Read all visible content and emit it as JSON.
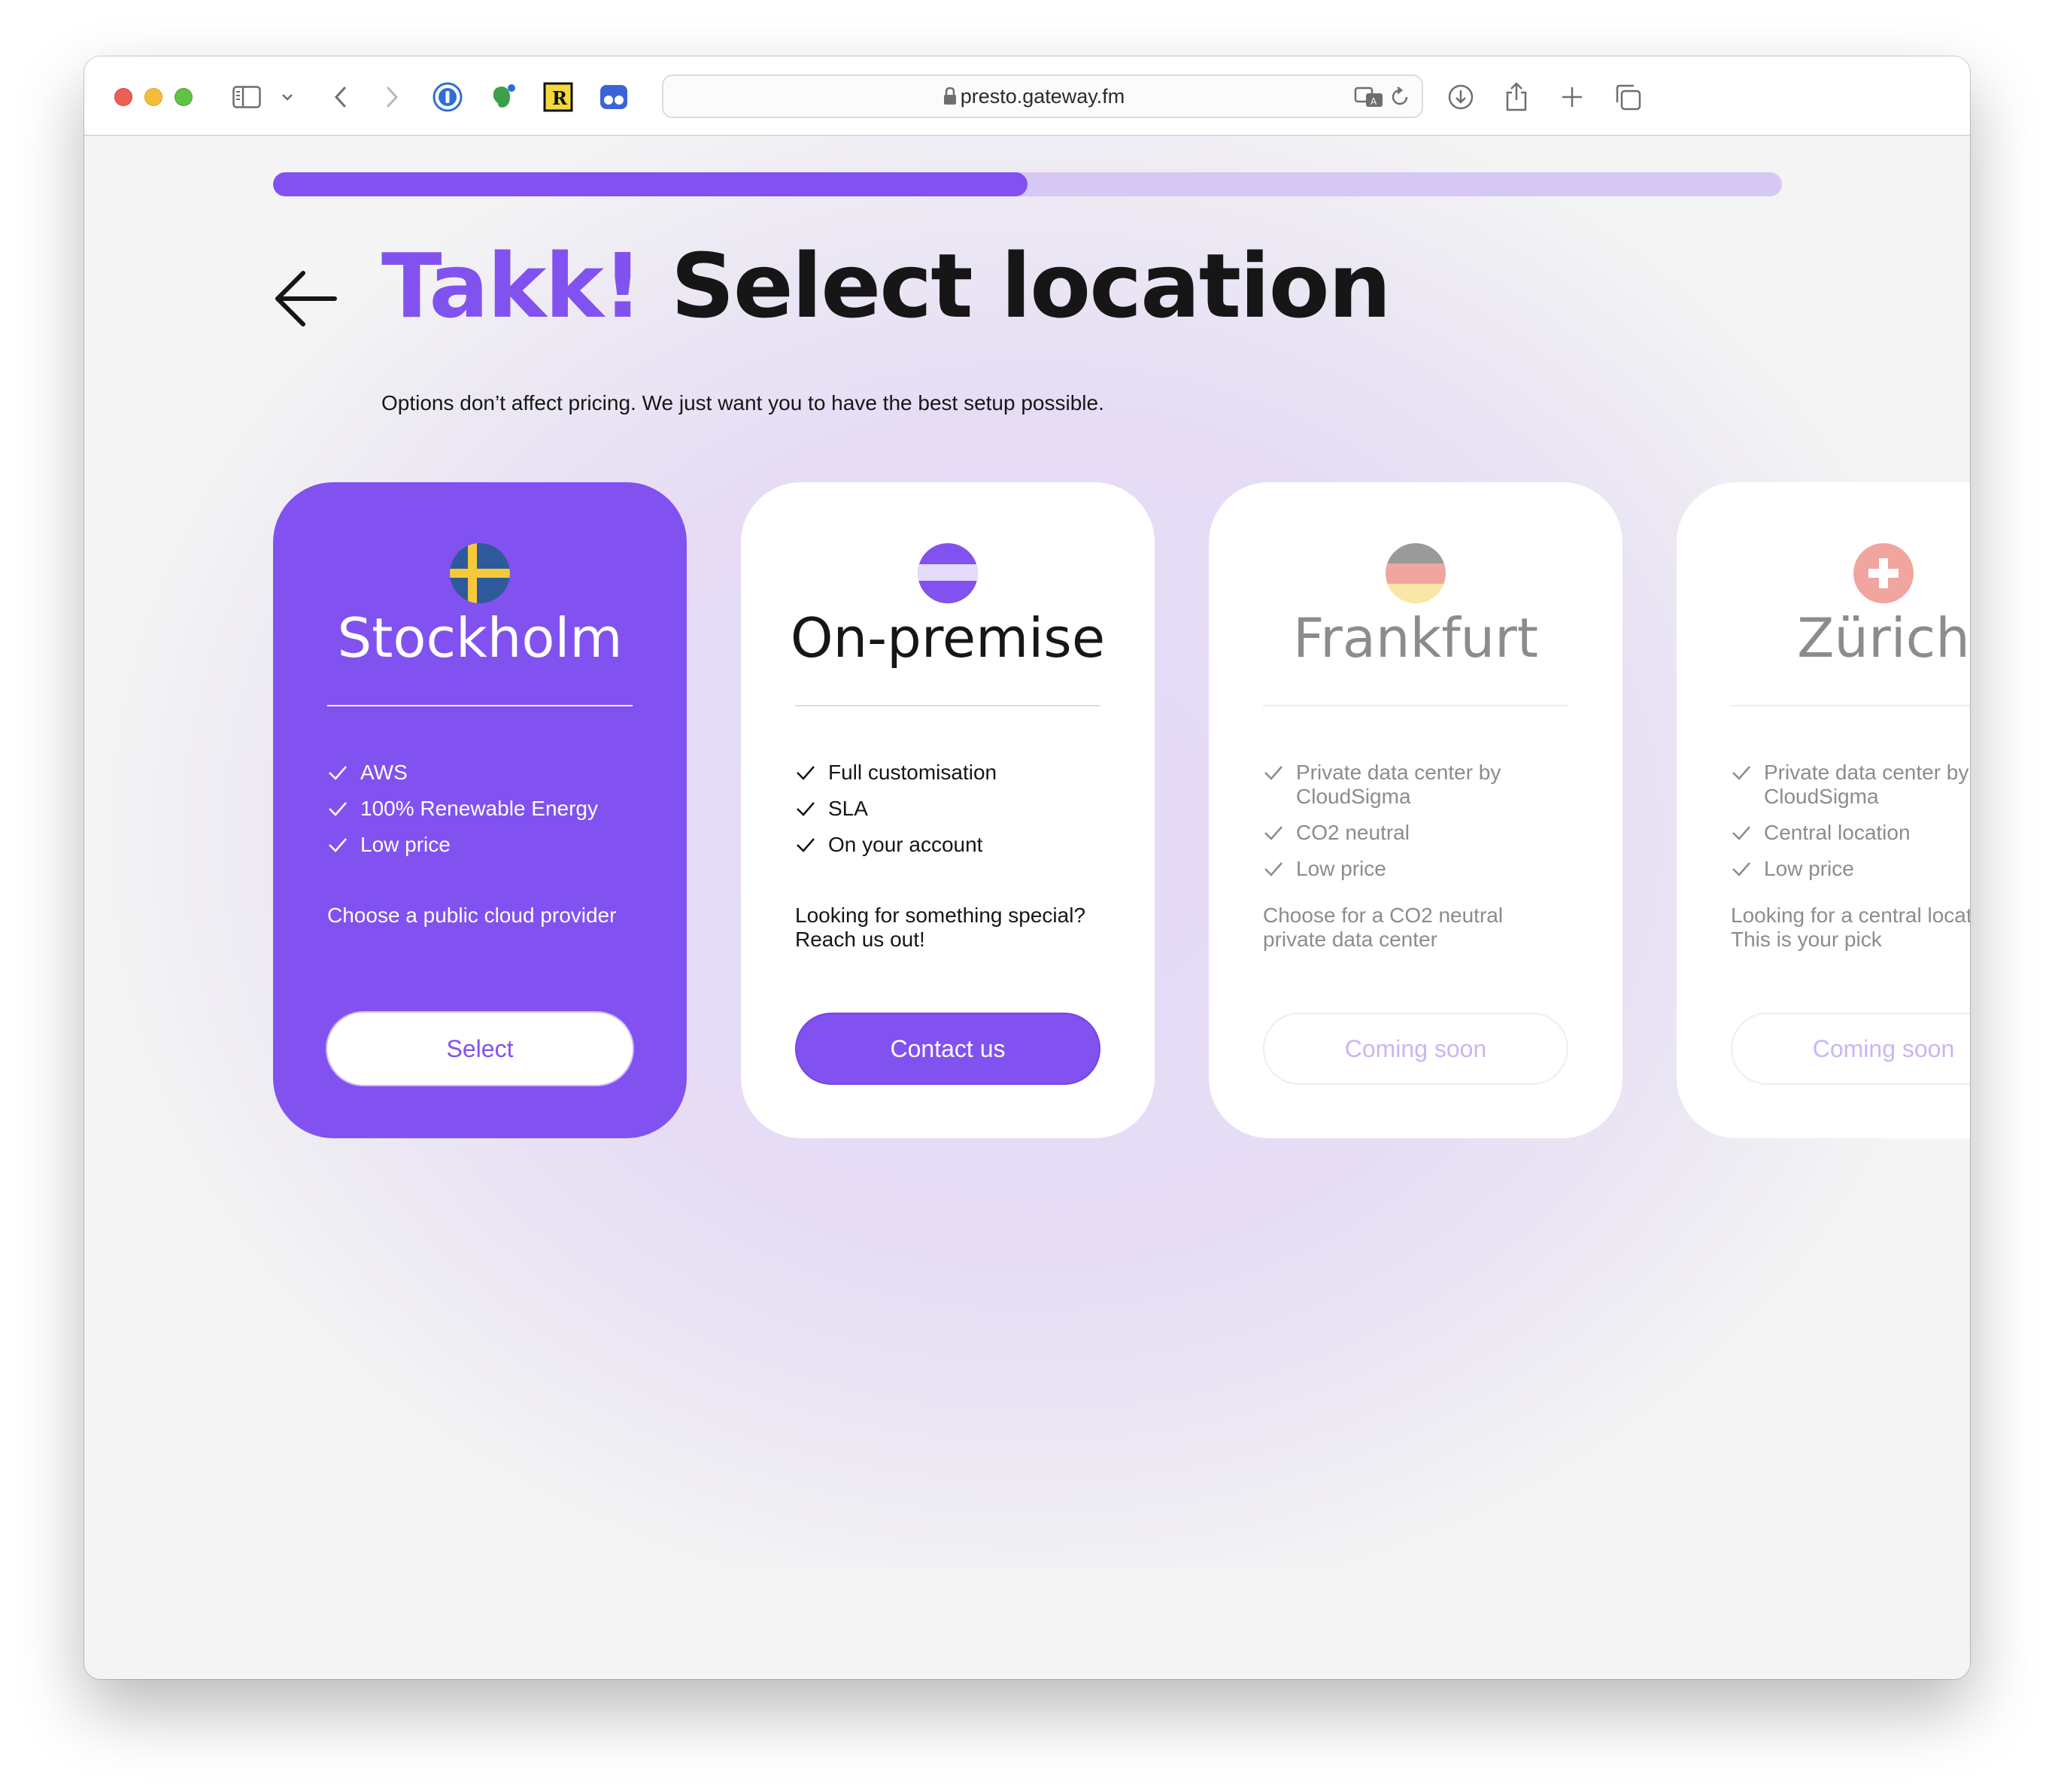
{
  "browser": {
    "url": "presto.gateway.fm",
    "toolbar_icons": [
      "sidebar-icon",
      "chevron-down-icon",
      "back-icon",
      "forward-icon",
      "password-manager-icon",
      "evernote-icon",
      "readwise-icon",
      "extension-icon",
      "translate-icon",
      "reload-icon",
      "download-icon",
      "share-icon",
      "new-tab-icon",
      "tab-overview-icon"
    ]
  },
  "onboarding": {
    "progress_percent": 50,
    "heading_accent": "Takk!",
    "heading_main": " Select location",
    "subtitle": "Options don’t affect pricing. We just want you to have the best setup possible."
  },
  "locations": [
    {
      "title": "Stockholm",
      "flag": "sweden-flag-icon",
      "state": "selected",
      "features": [
        "AWS",
        "100% Renewable Energy",
        "Low price"
      ],
      "description": "Choose a public cloud provider",
      "button_label": "Select"
    },
    {
      "title": "On-premise",
      "flag": "on-premise-flag-icon",
      "state": "active",
      "features": [
        "Full customisation",
        "SLA",
        "On your account"
      ],
      "description": "Looking for something special? Reach us out!",
      "button_label": "Contact us"
    },
    {
      "title": "Frankfurt",
      "flag": "germany-flag-icon",
      "state": "disabled",
      "features": [
        "Private data center by CloudSigma",
        "CO2 neutral",
        "Low price"
      ],
      "description": "Choose for a CO2 neutral private data center",
      "button_label": "Coming soon"
    },
    {
      "title": "Zürich",
      "flag": "switzerland-flag-icon",
      "state": "disabled",
      "features": [
        "Private data center by CloudSigma",
        "Central location",
        "Low price"
      ],
      "description": "Looking for a central location? This is your pick",
      "button_label": "Coming soon"
    }
  ],
  "colors": {
    "accent": "#8152ef",
    "accent_light": "#d6c8f4",
    "text": "#161616",
    "muted": "#8c8c8c"
  }
}
